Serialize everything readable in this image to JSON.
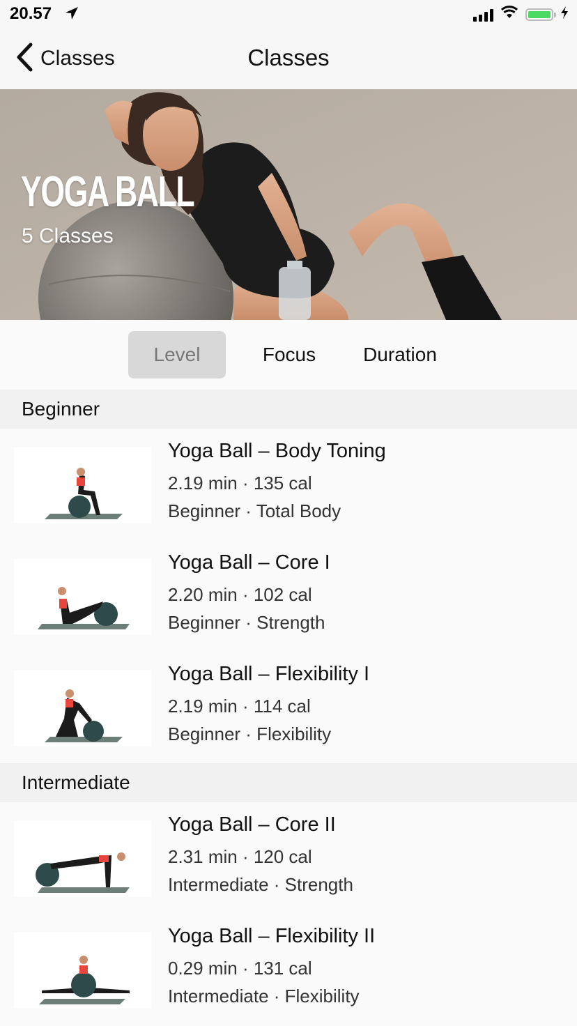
{
  "status_bar": {
    "time": "20.57",
    "icons": [
      "location-arrow-icon",
      "signal-icon",
      "wifi-icon",
      "battery-icon",
      "charging-icon"
    ],
    "battery_color": "#4cd964"
  },
  "nav": {
    "back_label": "Classes",
    "title": "Classes"
  },
  "hero": {
    "title": "YOGA BALL",
    "subtitle": "5 Classes"
  },
  "filters": {
    "tabs": [
      "Level",
      "Focus",
      "Duration"
    ],
    "selected": "Level"
  },
  "sections": [
    {
      "header": "Beginner",
      "items": [
        {
          "title": "Yoga Ball – Body Toning",
          "meta": "2.19 min · 135 cal",
          "tags": "Beginner · Total Body"
        },
        {
          "title": "Yoga Ball – Core I",
          "meta": "2.20 min · 102 cal",
          "tags": "Beginner · Strength"
        },
        {
          "title": "Yoga Ball – Flexibility I",
          "meta": "2.19 min · 114 cal",
          "tags": "Beginner · Flexibility"
        }
      ]
    },
    {
      "header": "Intermediate",
      "items": [
        {
          "title": "Yoga Ball – Core II",
          "meta": "2.31 min · 120 cal",
          "tags": "Intermediate · Strength"
        },
        {
          "title": "Yoga Ball – Flexibility II",
          "meta": "0.29 min · 131 cal",
          "tags": "Intermediate · Flexibility"
        }
      ]
    }
  ],
  "colors": {
    "ball": "#2f4a4a",
    "mat": "#6b7f78",
    "top": "#e8453c",
    "selected_tab_bg": "#d8d8d8"
  }
}
